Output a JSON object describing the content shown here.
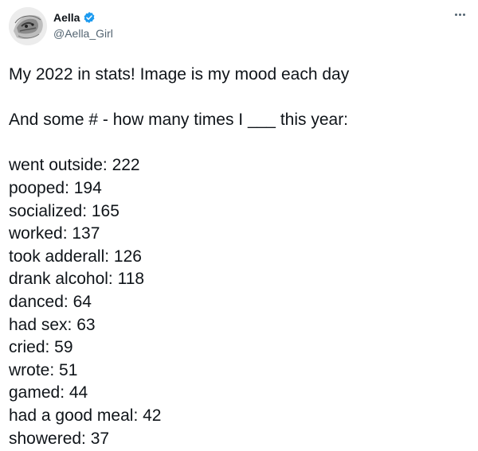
{
  "author": {
    "display_name": "Aella",
    "handle": "@Aella_Girl",
    "verified_icon": "verified-badge-icon",
    "verified_color": "#1d9bf0"
  },
  "menu": {
    "icon": "more-options-icon"
  },
  "tweet": {
    "intro": "My 2022 in stats! Image is my mood each day",
    "question": "And some # - how many times I ___ this year:",
    "stats": [
      "went outside: 222",
      "pooped: 194",
      "socialized: 165",
      "worked: 137",
      "took adderall: 126",
      "drank alcohol: 118",
      "danced: 64",
      "had sex: 63",
      "cried: 59",
      "wrote: 51",
      "gamed: 44",
      "had a good meal: 42",
      "showered: 37"
    ]
  },
  "colors": {
    "text_primary": "#0f1419",
    "text_secondary": "#536471"
  }
}
